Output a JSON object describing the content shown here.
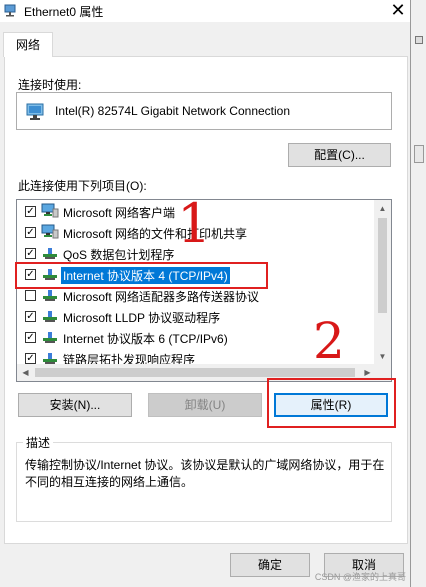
{
  "window": {
    "title": "Ethernet0 属性",
    "close_glyph": "✕"
  },
  "tabs": [
    {
      "label": "网络"
    }
  ],
  "connect_using": {
    "label": "连接时使用:",
    "adapter_name": "Intel(R) 82574L Gigabit Network Connection",
    "configure_label": "配置(C)..."
  },
  "items_section": {
    "label": "此连接使用下列项目(O):",
    "items": [
      {
        "label": "Microsoft 网络客户端",
        "checked": true,
        "icon": "network-client-icon"
      },
      {
        "label": "Microsoft 网络的文件和打印机共享",
        "checked": true,
        "icon": "file-print-share-icon"
      },
      {
        "label": "QoS 数据包计划程序",
        "checked": true,
        "icon": "qos-icon"
      },
      {
        "label": "Internet 协议版本 4 (TCP/IPv4)",
        "checked": true,
        "icon": "protocol-icon",
        "selected": true
      },
      {
        "label": "Microsoft 网络适配器多路传送器协议",
        "checked": false,
        "icon": "protocol-icon"
      },
      {
        "label": "Microsoft LLDP 协议驱动程序",
        "checked": true,
        "icon": "protocol-icon"
      },
      {
        "label": "Internet 协议版本 6 (TCP/IPv6)",
        "checked": true,
        "icon": "protocol-icon"
      },
      {
        "label": "链路层拓扑发现响应程序",
        "checked": true,
        "icon": "protocol-icon"
      }
    ]
  },
  "actions": {
    "install_label": "安装(N)...",
    "uninstall_label": "卸载(U)",
    "properties_label": "属性(R)"
  },
  "description": {
    "legend": "描述",
    "text": "传输控制协议/Internet 协议。该协议是默认的广域网络协议，用于在不同的相互连接的网络上通信。"
  },
  "footer": {
    "ok_label": "确定",
    "cancel_label": "取消"
  },
  "annotations": {
    "one": "1",
    "two": "2",
    "color": "#e02020"
  },
  "watermark": "CSDN @渔家的上真哥"
}
